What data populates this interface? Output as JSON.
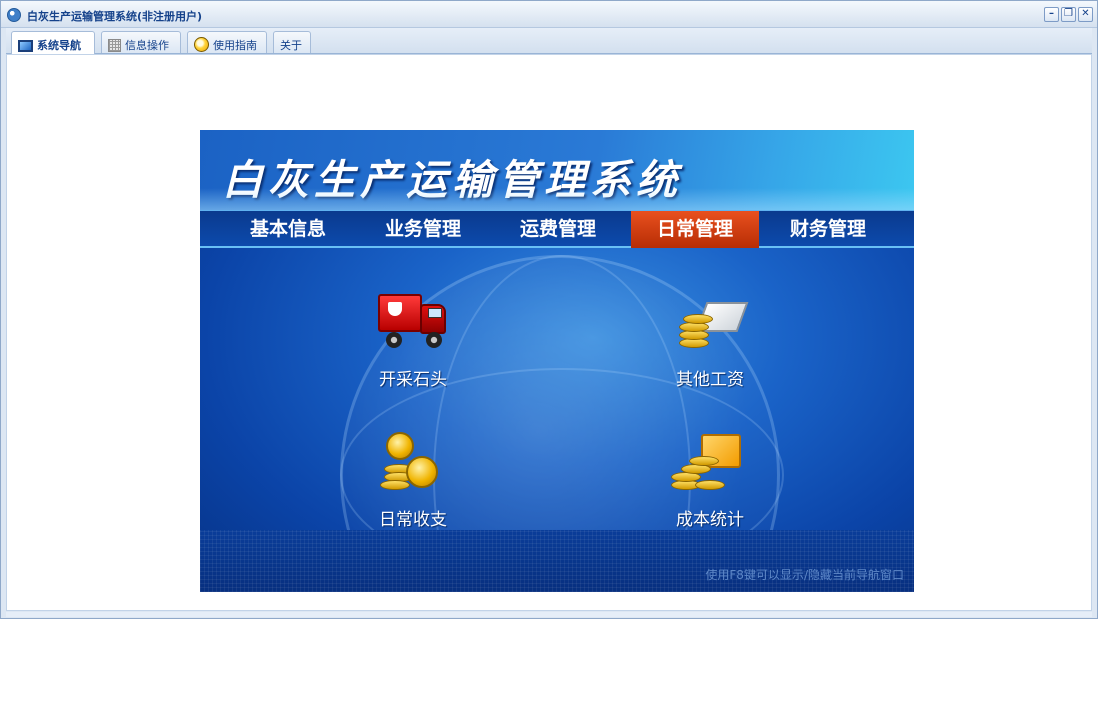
{
  "window": {
    "title": "白灰生产运输管理系统(非注册用户)",
    "controls": {
      "minimize": "–",
      "restore": "❐",
      "close": "✕"
    }
  },
  "tabs": [
    {
      "label": "系统导航",
      "icon": "monitor-icon",
      "active": true
    },
    {
      "label": "信息操作",
      "icon": "grid-icon",
      "active": false
    },
    {
      "label": "使用指南",
      "icon": "bulb-icon",
      "active": false
    },
    {
      "label": "关于",
      "icon": "",
      "active": false
    }
  ],
  "banner": {
    "title": "白灰生产运输管理系统",
    "menu": [
      "基本信息",
      "业务管理",
      "运费管理",
      "日常管理",
      "财务管理"
    ],
    "active_menu": "日常管理",
    "items": [
      {
        "label": "开采石头",
        "icon": "truck-icon"
      },
      {
        "label": "其他工资",
        "icon": "coins-laptop-icon"
      },
      {
        "label": "日常收支",
        "icon": "coins-icon"
      },
      {
        "label": "成本统计",
        "icon": "coins-chart-icon"
      }
    ],
    "hint": "使用F8键可以显示/隐藏当前导航窗口"
  },
  "colors": {
    "title_text": "#15428b",
    "active_menu": "#d03a0e",
    "banner_blue": "#0b44a8"
  }
}
